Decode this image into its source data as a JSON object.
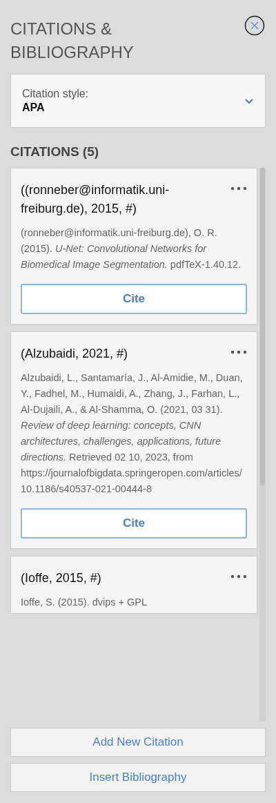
{
  "header": {
    "title": "CITATIONS & BIBLIOGRAPHY"
  },
  "style_select": {
    "label": "Citation style:",
    "value": "APA"
  },
  "citations_heading": "CITATIONS (5)",
  "citations": [
    {
      "title": "((ronneber@informatik.uni-freiburg.de), 2015, #)",
      "reference": "(ronneber@informatik.uni-freiburg.de), O. R. (2015). *U-Net: Convolutional Networks for Biomedical Image Segmentation.* pdfTeX-1.40.12.",
      "button": "Cite"
    },
    {
      "title": "(Alzubaidi, 2021, #)",
      "reference": "Alzubaidi, L., Santamaría, J., Al-Amidie, M., Duan, Y., Fadhel, M., Humaidi, A., Zhang, J., Farhan, L., Al-Dujaili, A., & Al-Shamma, O. (2021, 03 31). *Review of deep learning: concepts, CNN architectures, challenges, applications, future directions.* Retrieved  02 10, 2023, from https://journalofbigdata.springeropen.com/articles/10.1186/s40537-021-00444-8",
      "button": "Cite"
    },
    {
      "title": "(Ioffe, 2015, #)",
      "reference": "Ioffe, S. (2015). dvips + GPL"
    }
  ],
  "actions": [
    "Add New Citation",
    "Insert Bibliography"
  ]
}
